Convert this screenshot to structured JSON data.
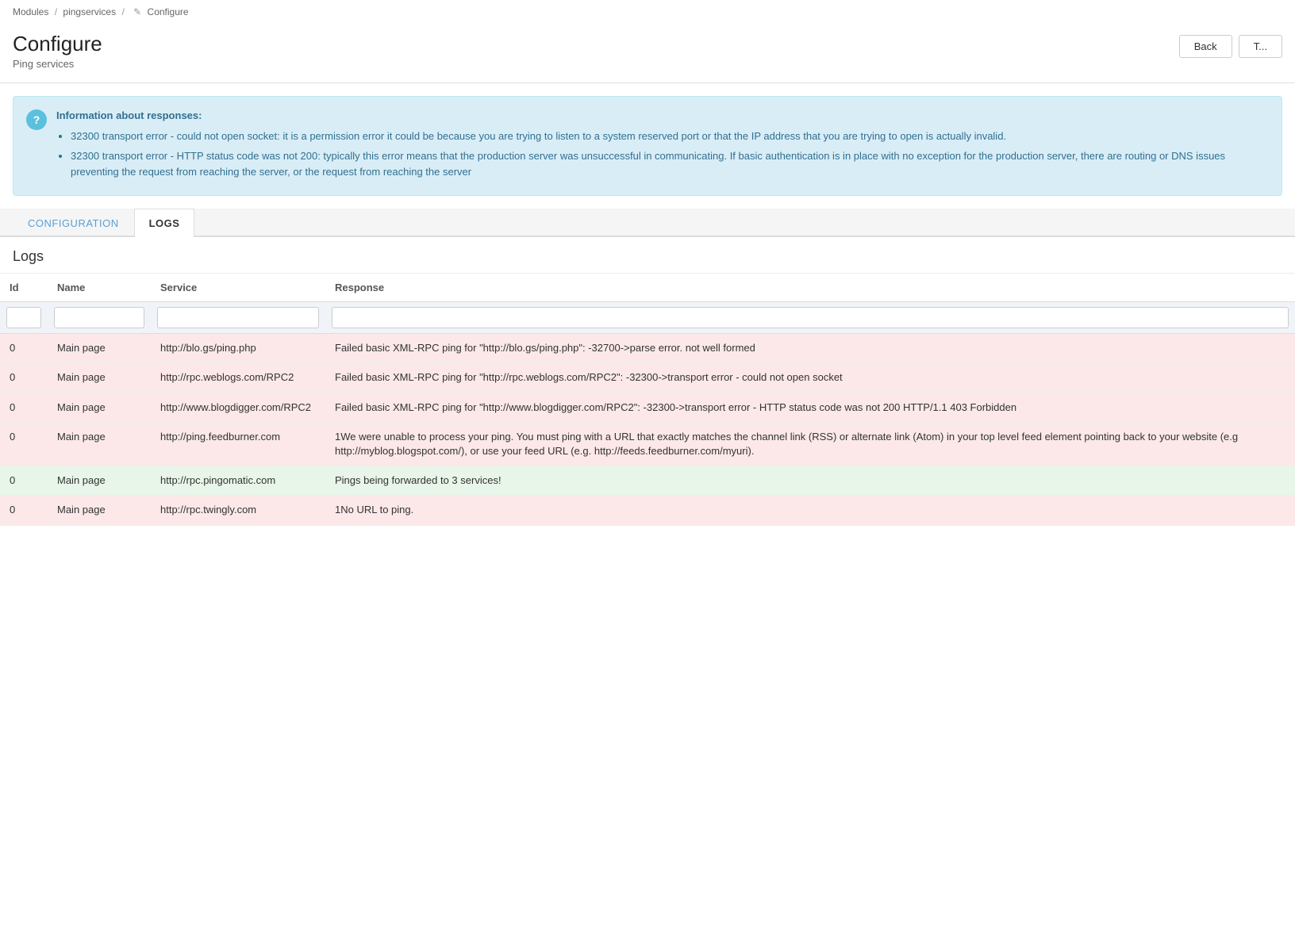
{
  "breadcrumb": {
    "items": [
      {
        "label": "Modules",
        "href": "#"
      },
      {
        "label": "pingservices",
        "href": "#"
      },
      {
        "label": "Configure",
        "href": "#"
      }
    ]
  },
  "header": {
    "title": "Configure",
    "subtitle": "Ping services",
    "back_button": "Back",
    "truncated_button": "T..."
  },
  "info_box": {
    "icon": "?",
    "title": "Information about responses:",
    "items": [
      "32300 transport error - could not open socket: it is a permission error it could be because you are trying to listen to a system reserved port or that the IP address that you are trying to open is actually invalid.",
      "32300 transport error - HTTP status code was not 200: typically this error means that the production server was unsuccessful in communicating. If basic authentication is in place with no exception for the production server, there are routing or DNS issues preventing the request from reaching the server, or the request from reaching the server"
    ]
  },
  "tabs": [
    {
      "label": "CONFIGURATION",
      "active": false
    },
    {
      "label": "LOGS",
      "active": true
    }
  ],
  "logs_section": {
    "title": "Logs",
    "columns": [
      {
        "label": "Id",
        "key": "id"
      },
      {
        "label": "Name",
        "key": "name"
      },
      {
        "label": "Service",
        "key": "service"
      },
      {
        "label": "Response",
        "key": "response"
      }
    ],
    "filter_placeholders": {
      "id": "",
      "name": "",
      "service": "",
      "response": ""
    },
    "rows": [
      {
        "id": "0",
        "name": "Main page",
        "service": "http://blo.gs/ping.php",
        "response": "Failed basic XML-RPC ping for \"http://blo.gs/ping.php\": -32700->parse error. not well formed",
        "status": "error"
      },
      {
        "id": "0",
        "name": "Main page",
        "service": "http://rpc.weblogs.com/RPC2",
        "response": "Failed basic XML-RPC ping for \"http://rpc.weblogs.com/RPC2\": -32300->transport error - could not open socket",
        "status": "error"
      },
      {
        "id": "0",
        "name": "Main page",
        "service": "http://www.blogdigger.com/RPC2",
        "response": "Failed basic XML-RPC ping for \"http://www.blogdigger.com/RPC2\": -32300->transport error - HTTP status code was not 200 HTTP/1.1 403 Forbidden",
        "status": "error"
      },
      {
        "id": "0",
        "name": "Main page",
        "service": "http://ping.feedburner.com",
        "response": "1We were unable to process your ping. You must ping with a URL that exactly matches the channel link (RSS) or alternate link (Atom) in your top level feed element pointing back to your website (e.g http://myblog.blogspot.com/), or use your feed URL (e.g. http://feeds.feedburner.com/myuri).",
        "status": "error"
      },
      {
        "id": "0",
        "name": "Main page",
        "service": "http://rpc.pingomatic.com",
        "response": "Pings being forwarded to 3 services!",
        "status": "success"
      },
      {
        "id": "0",
        "name": "Main page",
        "service": "http://rpc.twingly.com",
        "response": "1No URL to ping.",
        "status": "error"
      }
    ]
  }
}
